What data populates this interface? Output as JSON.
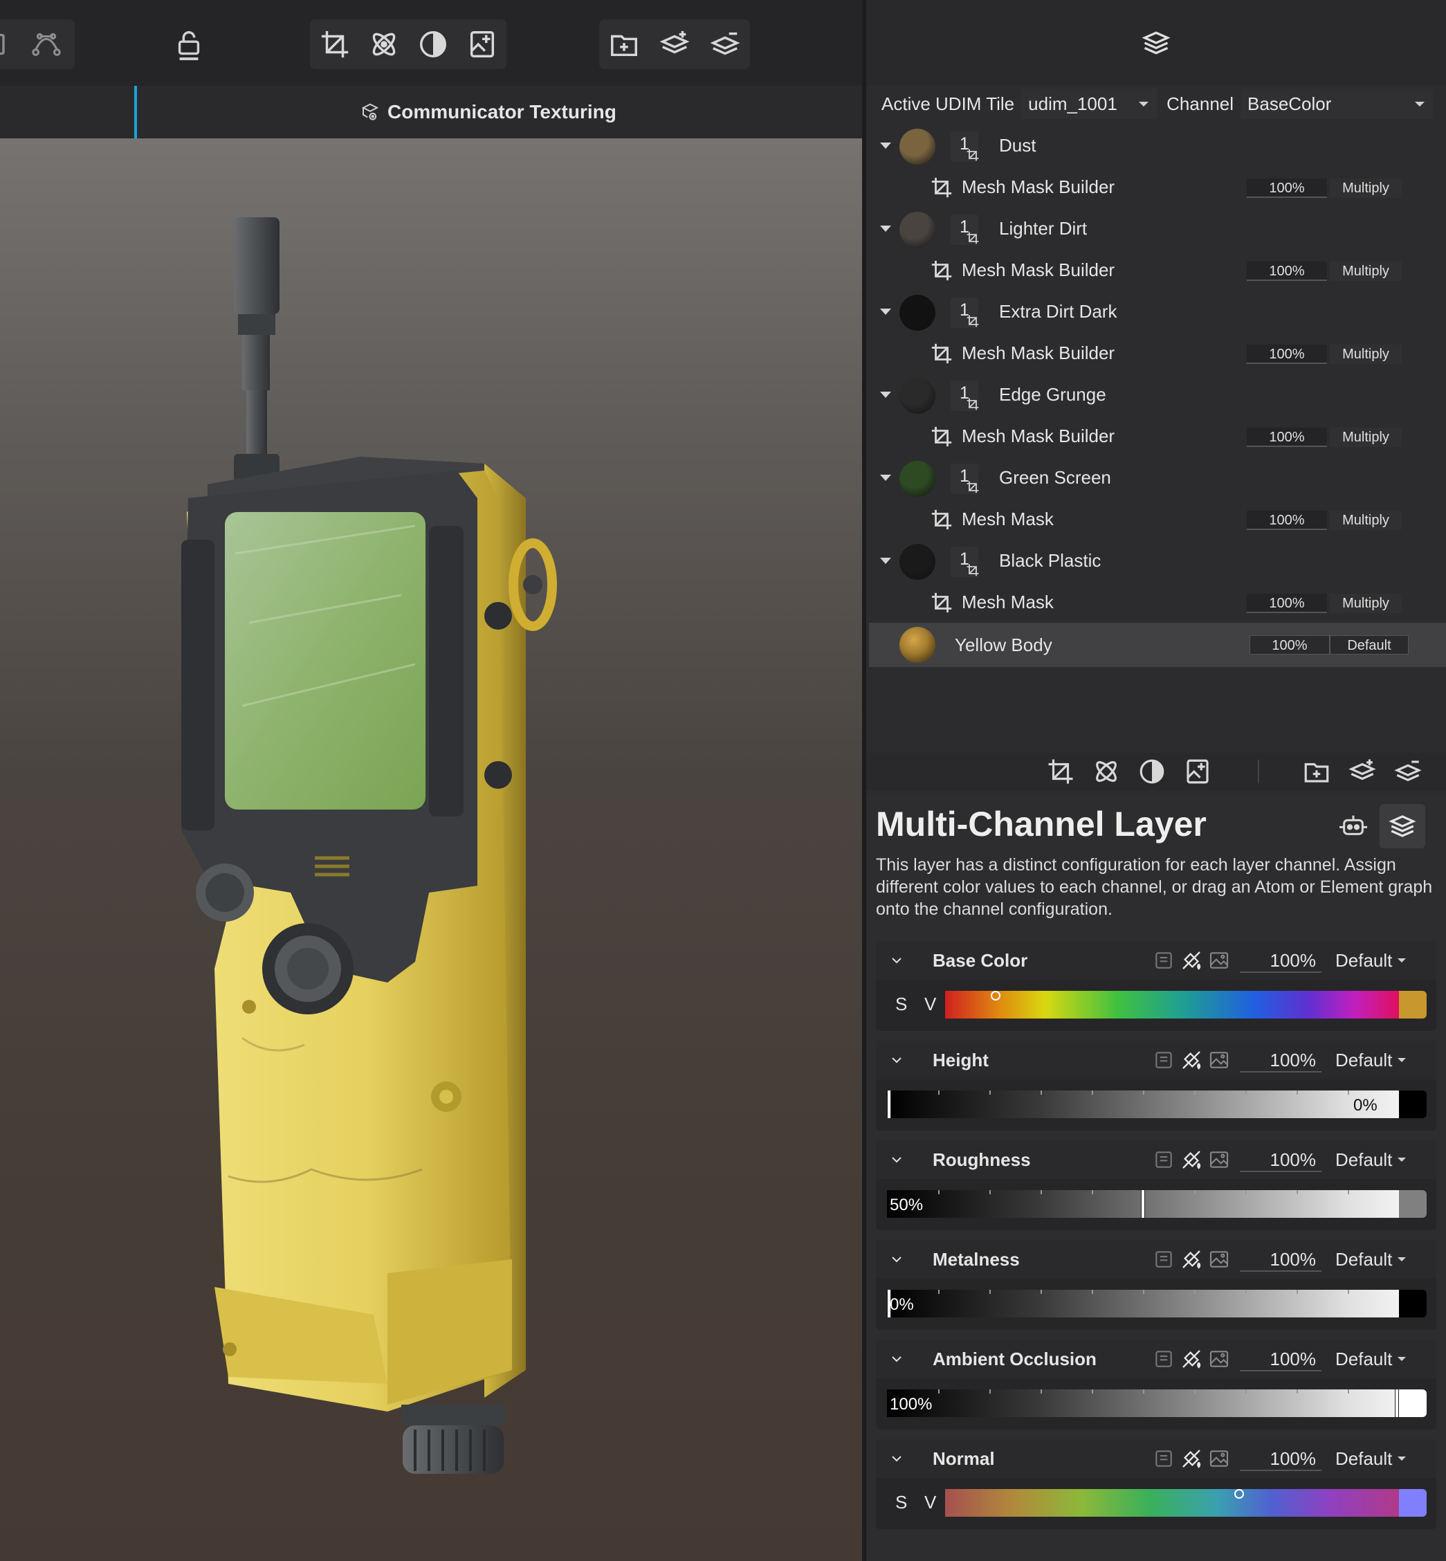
{
  "viewport": {
    "title": "Communicator Texturing"
  },
  "udim": {
    "label": "Active UDIM Tile",
    "tile": "udim_1001",
    "channel_label": "Channel",
    "channel": "BaseColor"
  },
  "layers": [
    {
      "name": "Dust",
      "count": "1",
      "mask": "Mesh Mask Builder",
      "opacity": "100%",
      "blend": "Multiply",
      "color": "#7a6440"
    },
    {
      "name": "Lighter Dirt",
      "count": "1",
      "mask": "Mesh Mask Builder",
      "opacity": "100%",
      "blend": "Multiply",
      "color": "#4a4440"
    },
    {
      "name": "Extra Dirt Dark",
      "count": "1",
      "mask": "Mesh Mask Builder",
      "opacity": "100%",
      "blend": "Multiply",
      "color": "#121212"
    },
    {
      "name": "Edge Grunge",
      "count": "1",
      "mask": "Mesh Mask Builder",
      "opacity": "100%",
      "blend": "Multiply",
      "color": "#2a2a2a"
    },
    {
      "name": "Green Screen",
      "count": "1",
      "mask": "Mesh Mask",
      "opacity": "100%",
      "blend": "Multiply",
      "color": "#2d4a22"
    },
    {
      "name": "Black Plastic",
      "count": "1",
      "mask": "Mesh Mask",
      "opacity": "100%",
      "blend": "Multiply",
      "color": "#1a1a1a"
    }
  ],
  "base_layer": {
    "name": "Yellow Body",
    "opacity": "100%",
    "blend": "Default",
    "color": "#a07a2e"
  },
  "props": {
    "title": "Multi-Channel Layer",
    "description": "This layer has a distinct configuration for each layer channel. Assign different color values to each channel, or drag an Atom or Element graph onto the channel configuration.",
    "channels": [
      {
        "name": "Base Color",
        "opacity": "100%",
        "mode": "Default",
        "s_label": "S",
        "v_label": "V",
        "swatch": "#c8982e",
        "value": ""
      },
      {
        "name": "Height",
        "opacity": "100%",
        "mode": "Default",
        "value": "0%",
        "level": 0
      },
      {
        "name": "Roughness",
        "opacity": "100%",
        "mode": "Default",
        "value": "50%",
        "level": 0.5
      },
      {
        "name": "Metalness",
        "opacity": "100%",
        "mode": "Default",
        "value": "0%",
        "level": 0
      },
      {
        "name": "Ambient Occlusion",
        "opacity": "100%",
        "mode": "Default",
        "value": "100%",
        "level": 1
      },
      {
        "name": "Normal",
        "opacity": "100%",
        "mode": "Default",
        "s_label": "S",
        "v_label": "V",
        "swatch": "#8080ff",
        "value": ""
      }
    ]
  },
  "colors": {
    "accent": "#1aa3d6",
    "panel": "#2c2c2e",
    "selected_row": "#414144"
  }
}
